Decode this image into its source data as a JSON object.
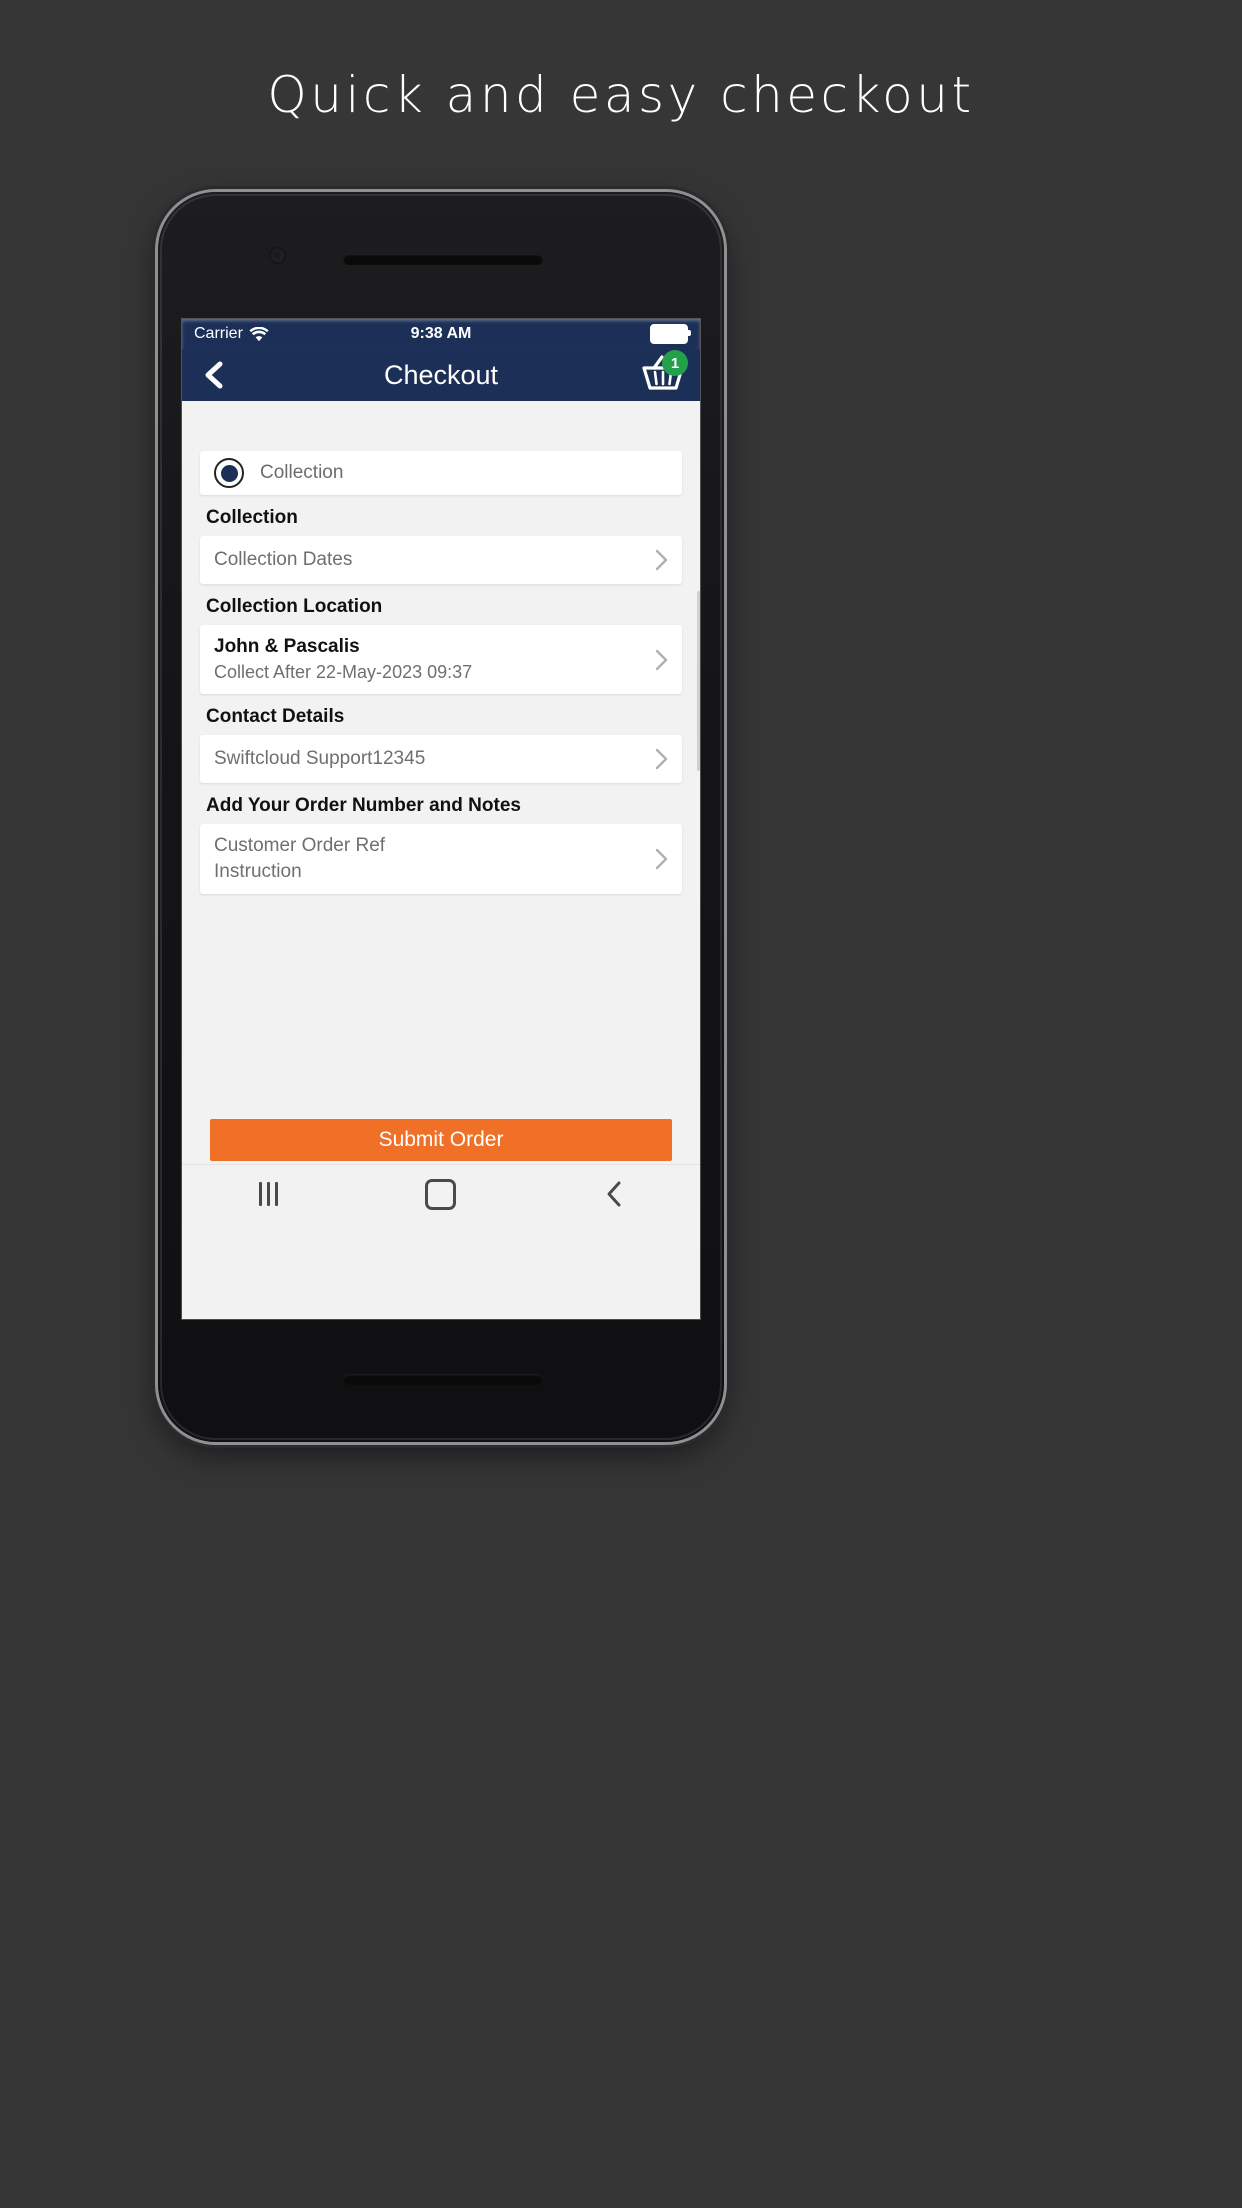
{
  "headline": "Quick and easy checkout",
  "statusbar": {
    "carrier": "Carrier",
    "wifi_icon": "wifi-icon",
    "time": "9:38 AM",
    "battery_icon": "battery-full-icon"
  },
  "navbar": {
    "back_icon": "chevron-left-icon",
    "title": "Checkout",
    "cart_icon": "shopping-basket-icon",
    "cart_badge": "1"
  },
  "form": {
    "fulfilment_radio": {
      "label": "Collection",
      "selected": true,
      "icon": "radio-selected-icon"
    },
    "sections": [
      {
        "heading": "Collection",
        "rows": [
          {
            "title": "Collection Dates",
            "sub": "",
            "bold": false,
            "chevron": "chevron-right-icon"
          }
        ]
      },
      {
        "heading": "Collection Location",
        "rows": [
          {
            "title": "John & Pascalis",
            "sub": "Collect After 22-May-2023 09:37",
            "bold": true,
            "chevron": "chevron-right-icon"
          }
        ]
      },
      {
        "heading": "Contact Details",
        "rows": [
          {
            "title": "Swiftcloud Support12345",
            "sub": "",
            "bold": false,
            "chevron": "chevron-right-icon"
          }
        ]
      },
      {
        "heading": "Add Your Order Number and Notes",
        "rows": [
          {
            "title": "Customer Order Ref",
            "sub": "Instruction",
            "bold": false,
            "chevron": "chevron-right-icon"
          }
        ]
      }
    ],
    "submit_label": "Submit Order"
  },
  "android_nav": {
    "recents_icon": "recents-icon",
    "home_icon": "home-icon",
    "back_icon": "back-icon"
  },
  "colors": {
    "background": "#363636",
    "header_navy": "#1c2f57",
    "accent_orange": "#f07028",
    "badge_green": "#22a04a",
    "screen_bg": "#f2f2f2",
    "card_white": "#ffffff"
  }
}
